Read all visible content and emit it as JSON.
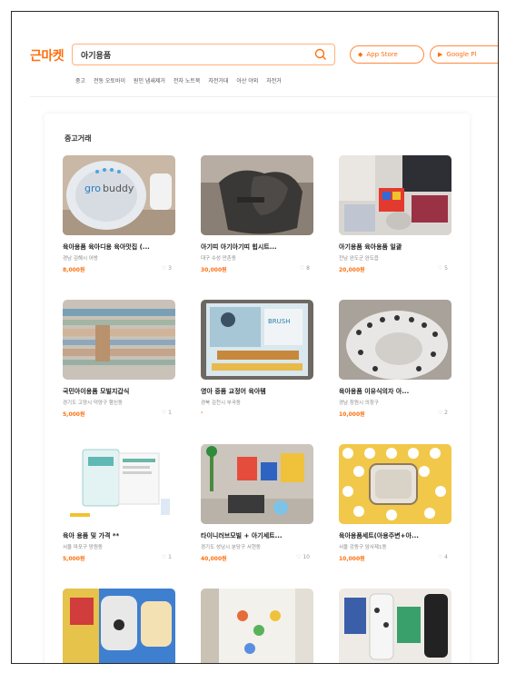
{
  "header": {
    "logo": "근마켓",
    "search_query": "아기용품",
    "app_store_label": "App Store",
    "google_play_label": "Google Pl",
    "keywords": [
      "중고",
      "전동 오토바이",
      "원인 냄새제거",
      "전자 노트북",
      "자전거대",
      "아산 야외",
      "자전거"
    ]
  },
  "section": {
    "title": "중고거래"
  },
  "products": [
    {
      "title": "육아용품 육아디용 육아맛집 (...",
      "location": "경남 김해시 어방",
      "price": "8,000원",
      "likes": "3"
    },
    {
      "title": "아기띠 아기아기띠 힙시트...",
      "location": "대구 수성 만촌동",
      "price": "30,000원",
      "likes": "8"
    },
    {
      "title": "아기용품 육아용품 일괄",
      "location": "전남 완도군 완도읍",
      "price": "20,000원",
      "likes": "5"
    },
    {
      "title": "국민아이용품 모빌지갑식",
      "location": "경기도 고양시 덕양구 행신동",
      "price": "5,000원",
      "likes": "1"
    },
    {
      "title": "영아 중품 교정어 육아템",
      "location": "경북 김천시 부곡동",
      "price": "-",
      "likes": ""
    },
    {
      "title": "육아용품 이유식의자 아...",
      "location": "경남 창원시 의창구",
      "price": "10,000원",
      "likes": "2"
    },
    {
      "title": "육아 용품 및 가격 **",
      "location": "서울 마포구 망원동",
      "price": "5,000원",
      "likes": "1"
    },
    {
      "title": "타이니러브모빌 + 아기세트...",
      "location": "경기도 성남시 분당구 서현동",
      "price": "40,000원",
      "likes": "10"
    },
    {
      "title": "육아용품세트(아용주변+아...",
      "location": "서울 강동구 암사제1동",
      "price": "10,000원",
      "likes": "4"
    },
    {
      "title": "",
      "location": "",
      "price": "",
      "likes": ""
    },
    {
      "title": "",
      "location": "",
      "price": "",
      "likes": ""
    },
    {
      "title": "",
      "location": "",
      "price": "",
      "likes": ""
    }
  ],
  "colors": {
    "brand": "#ff6f0f",
    "search_border": "#ffb17a"
  },
  "icons": {
    "search": "search-icon",
    "apple": "apple-icon",
    "google_play": "play-icon",
    "heart": "heart-icon"
  }
}
